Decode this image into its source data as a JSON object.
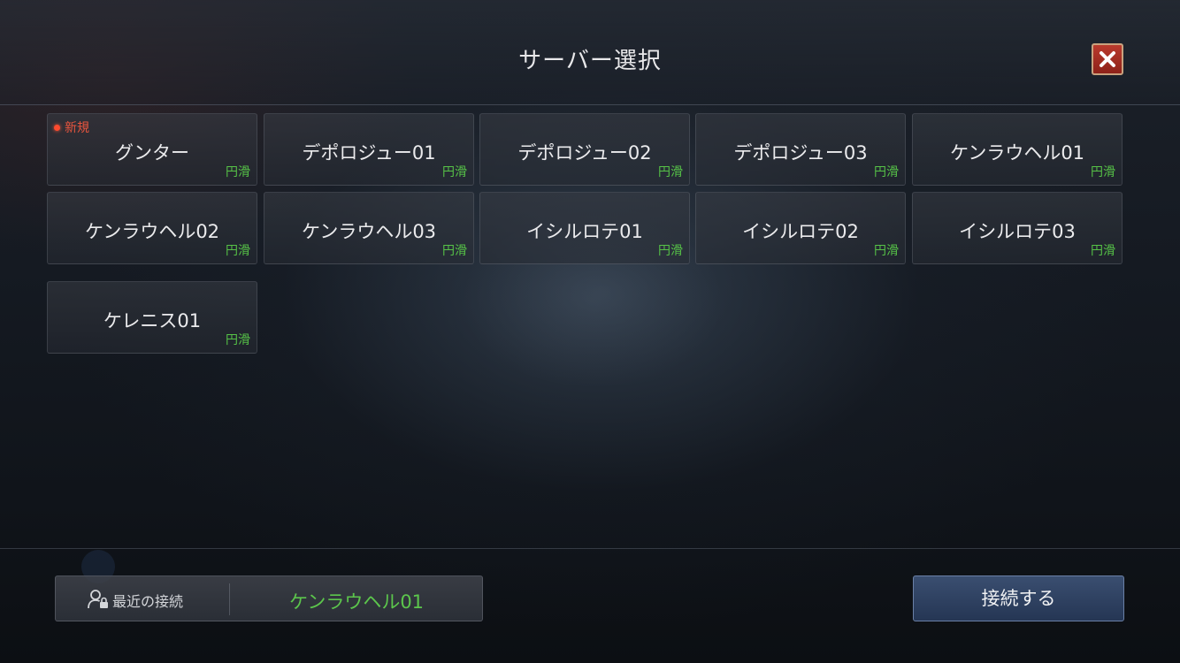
{
  "header": {
    "title": "サーバー選択",
    "close_icon": "close-icon"
  },
  "servers": [
    {
      "name": "グンター",
      "status": "円滑",
      "badge": "新規"
    },
    {
      "name": "デポロジュー01",
      "status": "円滑"
    },
    {
      "name": "デポロジュー02",
      "status": "円滑"
    },
    {
      "name": "デポロジュー03",
      "status": "円滑"
    },
    {
      "name": "ケンラウヘル01",
      "status": "円滑"
    },
    {
      "name": "ケンラウヘル02",
      "status": "円滑"
    },
    {
      "name": "ケンラウヘル03",
      "status": "円滑"
    },
    {
      "name": "イシルロテ01",
      "status": "円滑"
    },
    {
      "name": "イシルロテ02",
      "status": "円滑"
    },
    {
      "name": "イシルロテ03",
      "status": "円滑"
    },
    {
      "name": "ケレニス01",
      "status": "円滑"
    }
  ],
  "footer": {
    "recent_label": "最近の接続",
    "recent_icon": "user-lock-icon",
    "recent_server": "ケンラウヘル01",
    "connect_label": "接続する"
  },
  "colors": {
    "status_green": "#56c247",
    "badge_red": "#ff4a2e",
    "close_red": "#b93a2d",
    "connect_blue": "#2e4262"
  }
}
